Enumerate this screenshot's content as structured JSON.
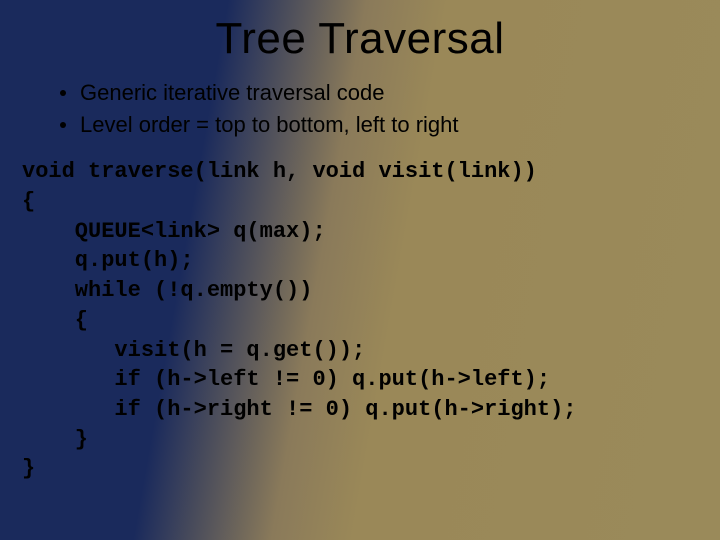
{
  "title": "Tree Traversal",
  "bullets": [
    "Generic iterative traversal code",
    "Level order = top to bottom, left to right"
  ],
  "code": "void traverse(link h, void visit(link))\n{\n    QUEUE<link> q(max);\n    q.put(h);\n    while (!q.empty())\n    {\n       visit(h = q.get());\n       if (h->left != 0) q.put(h->left);\n       if (h->right != 0) q.put(h->right);\n    }\n}"
}
